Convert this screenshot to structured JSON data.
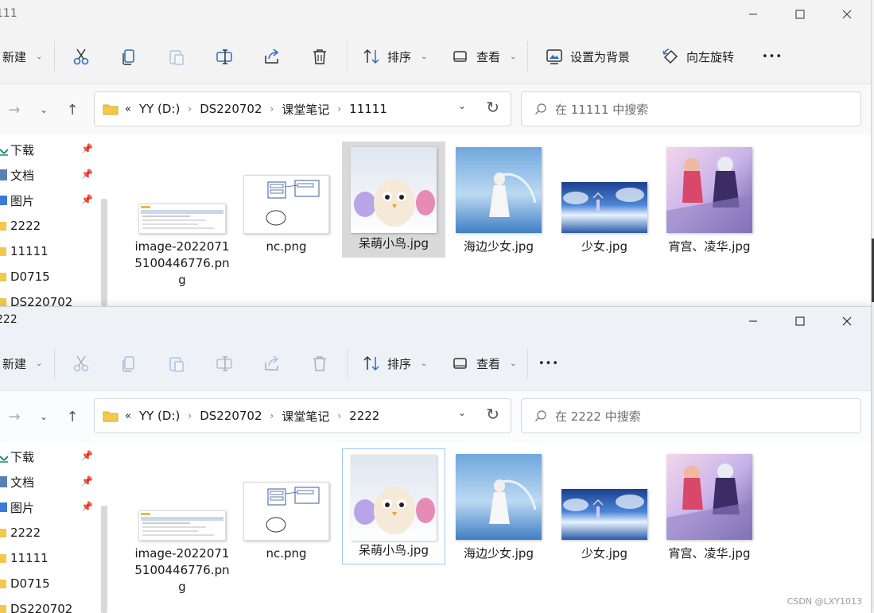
{
  "window1": {
    "title": "111",
    "toolbar": {
      "new_label": "新建",
      "sort_label": "排序",
      "view_label": "查看",
      "set_bg_label": "设置为背景",
      "rotate_label": "向左旋转",
      "more_label": "•••"
    },
    "address": {
      "prefix": "«",
      "crumbs": [
        "YY (D:)",
        "DS220702",
        "课堂笔记",
        "11111"
      ]
    },
    "search_placeholder": "在 11111 中搜索",
    "sidebar": [
      {
        "label": "下载",
        "pinned": true
      },
      {
        "label": "文档",
        "pinned": true
      },
      {
        "label": "图片",
        "pinned": true
      },
      {
        "label": "2222",
        "pinned": false
      },
      {
        "label": "11111",
        "pinned": false
      },
      {
        "label": "D0715",
        "pinned": false
      },
      {
        "label": "DS220702",
        "pinned": false
      }
    ],
    "files": [
      {
        "name": "image-20220715100446776.png",
        "line1": "image-2022071",
        "line2": "5100446776.pn",
        "line3": "g"
      },
      {
        "name": "nc.png"
      },
      {
        "name": "呆萌小鸟.jpg",
        "state": "selected"
      },
      {
        "name": "海边少女.jpg"
      },
      {
        "name": "少女.jpg"
      },
      {
        "name": "宵宫、凌华.jpg"
      }
    ]
  },
  "window2": {
    "title": "222",
    "toolbar": {
      "new_label": "新建",
      "sort_label": "排序",
      "view_label": "查看",
      "more_label": "•••"
    },
    "address": {
      "prefix": "«",
      "crumbs": [
        "YY (D:)",
        "DS220702",
        "课堂笔记",
        "2222"
      ]
    },
    "search_placeholder": "在 2222 中搜索",
    "sidebar": [
      {
        "label": "下载",
        "pinned": true
      },
      {
        "label": "文档",
        "pinned": true
      },
      {
        "label": "图片",
        "pinned": true
      },
      {
        "label": "2222",
        "pinned": false
      },
      {
        "label": "11111",
        "pinned": false
      },
      {
        "label": "D0715",
        "pinned": false
      },
      {
        "label": "DS220702",
        "pinned": false
      }
    ],
    "files": [
      {
        "name": "image-20220715100446776.png",
        "line1": "image-2022071",
        "line2": "5100446776.pn",
        "line3": "g"
      },
      {
        "name": "nc.png"
      },
      {
        "name": "呆萌小鸟.jpg",
        "state": "focused"
      },
      {
        "name": "海边少女.jpg"
      },
      {
        "name": "少女.jpg"
      },
      {
        "name": "宵宫、凌华.jpg"
      }
    ]
  },
  "watermark": "CSDN @LXY1013",
  "colors": {
    "folder": "#f2c94c",
    "selected_bg": "#d9d9d9",
    "focus_border": "#99c9ef",
    "accent_blue": "#2f6fbe"
  }
}
